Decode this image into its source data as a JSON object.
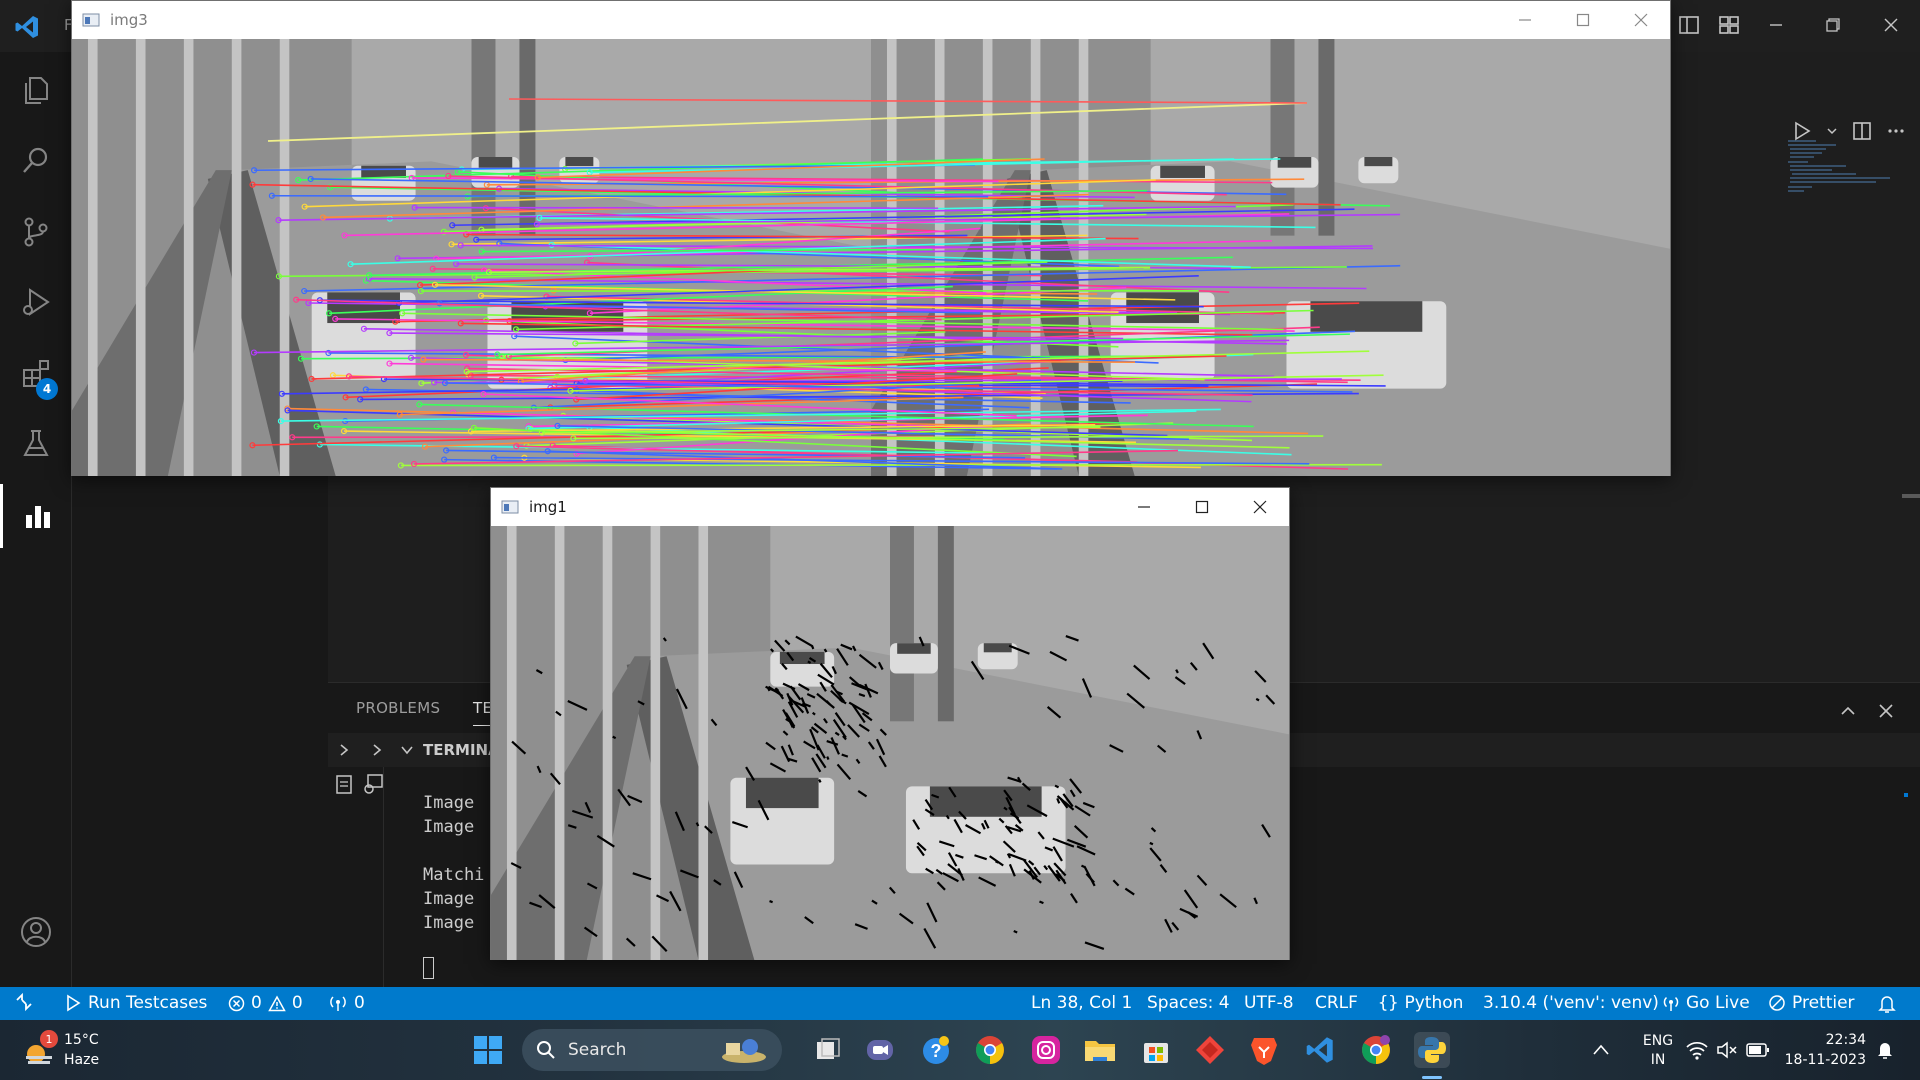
{
  "vscode": {
    "title_char": "F",
    "activity_badge": "4"
  },
  "panel": {
    "tabs": [
      "PROBLEMS",
      "TE"
    ],
    "terminal_section": "TERMINA",
    "terminal_lines": [
      "Image",
      "Image",
      "",
      "Matchi",
      "Image",
      "Image"
    ]
  },
  "statusbar": {
    "run_testcases": "Run Testcases",
    "errors": "0",
    "warnings": "0",
    "ports": "0",
    "position": "Ln 38, Col 1",
    "spaces": "Spaces: 4",
    "encoding": "UTF-8",
    "eol": "CRLF",
    "language": "Python",
    "interpreter": "3.10.4 ('venv': venv)",
    "go_live": "Go Live",
    "prettier": "Prettier"
  },
  "windows": {
    "img3": {
      "title": "img3"
    },
    "img1": {
      "title": "img1"
    }
  },
  "taskbar": {
    "weather_temp": "15°C",
    "weather_desc": "Haze",
    "weather_badge": "1",
    "search": "Search",
    "lang_top": "ENG",
    "lang_bottom": "IN",
    "time": "22:34",
    "date": "18-11-2023"
  },
  "colors": {
    "statusbar": "#007acc",
    "activity_bg": "#181818",
    "editor_bg": "#1e1e1e"
  }
}
